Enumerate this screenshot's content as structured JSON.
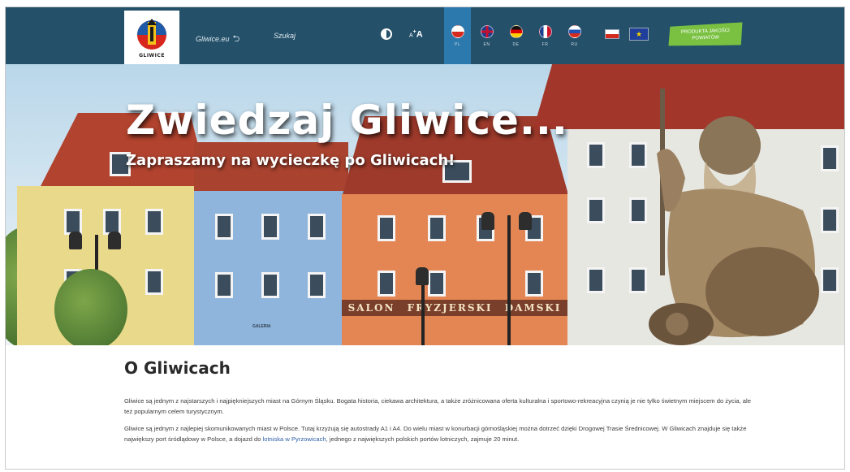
{
  "header": {
    "logo_text": "GLIWICE",
    "nav_link_site": "Gliwice.eu",
    "nav_link_search": "Szukaj",
    "font_size_label": "A",
    "font_size_small": "A",
    "languages": [
      {
        "code": "PL",
        "active": true
      },
      {
        "code": "EN",
        "active": false
      },
      {
        "code": "DE",
        "active": false
      },
      {
        "code": "FR",
        "active": false
      },
      {
        "code": "RU",
        "active": false
      }
    ],
    "eu_stars": "★",
    "cta_label": "PRODUKTA JAKOŚCI POWIATÓW"
  },
  "hero": {
    "title": "Zwiedzaj Gliwice...",
    "subtitle": "Zapraszamy na wycieczkę po Gliwicach!",
    "shop_sign": [
      "SALON",
      "FRYZJERSKI",
      "DAMSKI"
    ],
    "shop_sign_small": "GALERIA"
  },
  "about": {
    "title": "O Gliwicach",
    "p1": "Gliwice są jednym z najstarszych i najpiękniejszych miast na Górnym Śląsku. Bogata historia, ciekawa architektura, a także zróżnicowana oferta kulturalna i sportowo-rekreacyjna czynią je nie tylko świetnym miejscem do życia, ale też popularnym celem turystycznym.",
    "p2_before": "Gliwice są jednym z najlepiej skomunikowanych miast w Polsce. Tutaj krzyżują się autostrady A1 i A4. Do wielu miast w konurbacji górnośląskiej można dotrzeć dzięki Drogowej Trasie Średnicowej. W Gliwicach znajduje się także największy port śródlądowy w Polsce, a dojazd do ",
    "p2_link": "lotniska w Pyrzowicach",
    "p2_after": ", jednego z największych polskich portów lotniczych, zajmuje 20 minut."
  },
  "colors": {
    "header_bg": "#245069",
    "active_lang_bg": "#2c79ad",
    "cta_bg": "#7ac142",
    "link": "#2c5fa8"
  }
}
